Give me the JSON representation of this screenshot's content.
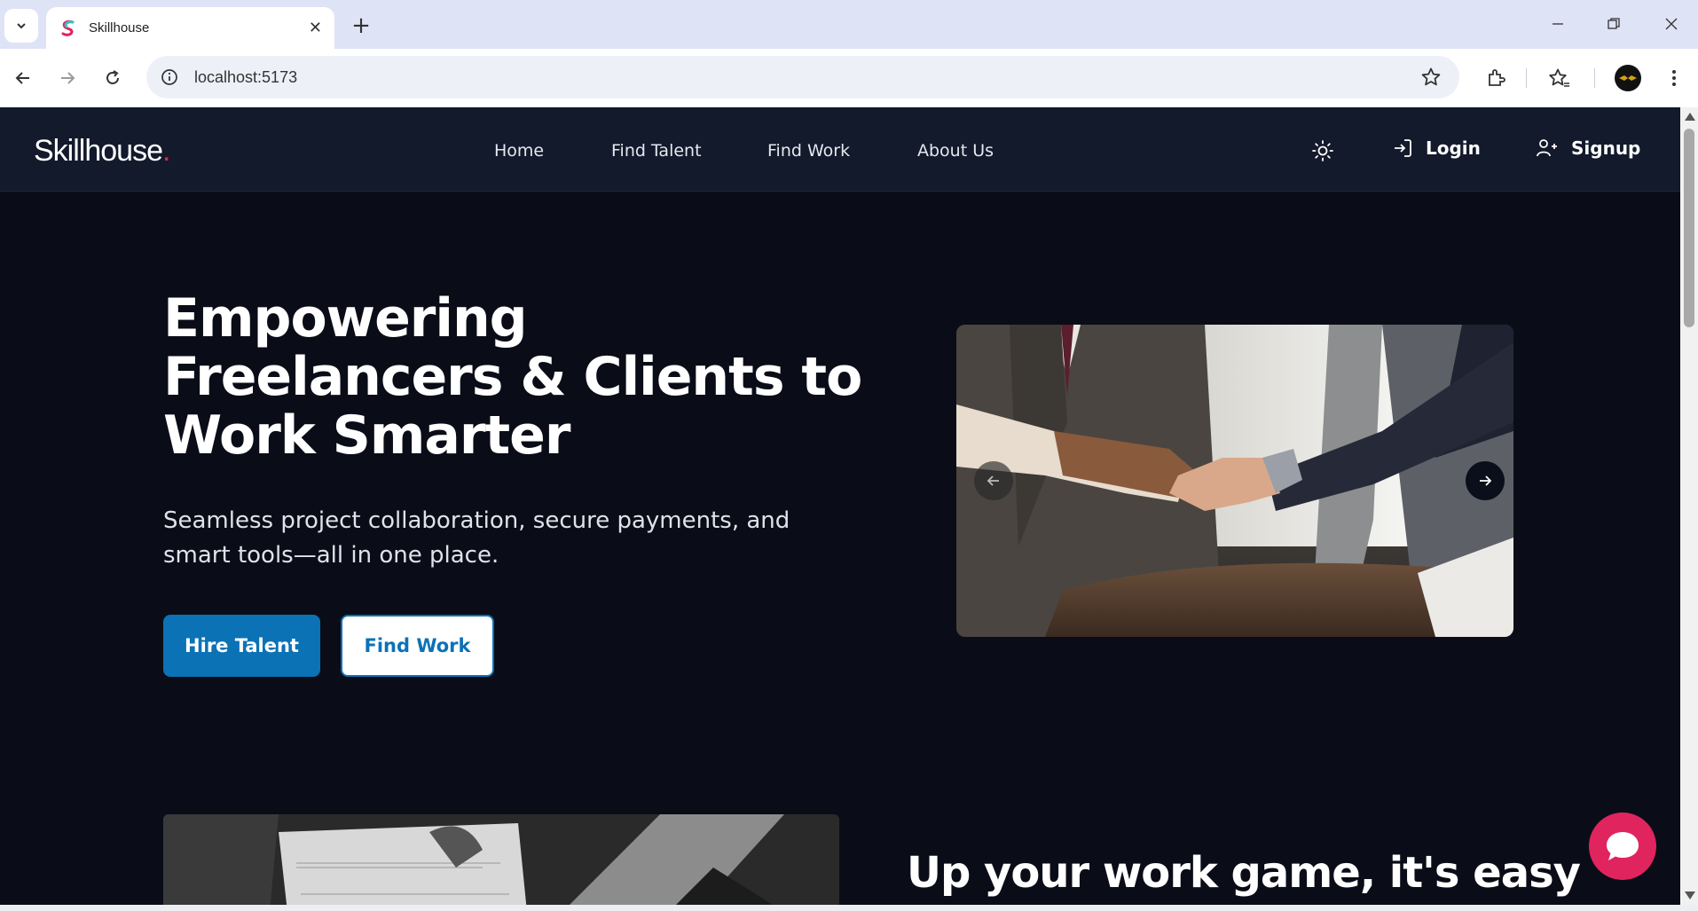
{
  "browser": {
    "tab_title": "Skillhouse",
    "url": "localhost:5173"
  },
  "header": {
    "logo_text": "Skillhouse",
    "logo_dot": ".",
    "nav": [
      "Home",
      "Find Talent",
      "Find Work",
      "About Us"
    ],
    "login_label": "Login",
    "signup_label": "Signup"
  },
  "hero": {
    "title": "Empowering Freelancers & Clients to Work Smarter",
    "subtitle": "Seamless project collaboration, secure payments, and smart tools—all in one place.",
    "hire_button": "Hire Talent",
    "find_button": "Find Work"
  },
  "feature": {
    "title": "Up your work game, it's easy"
  },
  "colors": {
    "page_bg": "#0a0d17",
    "header_bg": "#121a2b",
    "primary": "#0b72b6",
    "accent_dot": "#e8224c",
    "chat_button": "#e0245e"
  },
  "icons": [
    "tab-list-icon",
    "favicon-icon",
    "close-icon",
    "plus-icon",
    "minimize-icon",
    "restore-icon",
    "back-icon",
    "forward-icon",
    "reload-icon",
    "info-icon",
    "star-icon",
    "extensions-icon",
    "bookmarks-icon",
    "menu-icon",
    "sun-icon",
    "login-icon",
    "user-plus-icon",
    "arrow-left-icon",
    "arrow-right-icon",
    "chat-icon"
  ]
}
